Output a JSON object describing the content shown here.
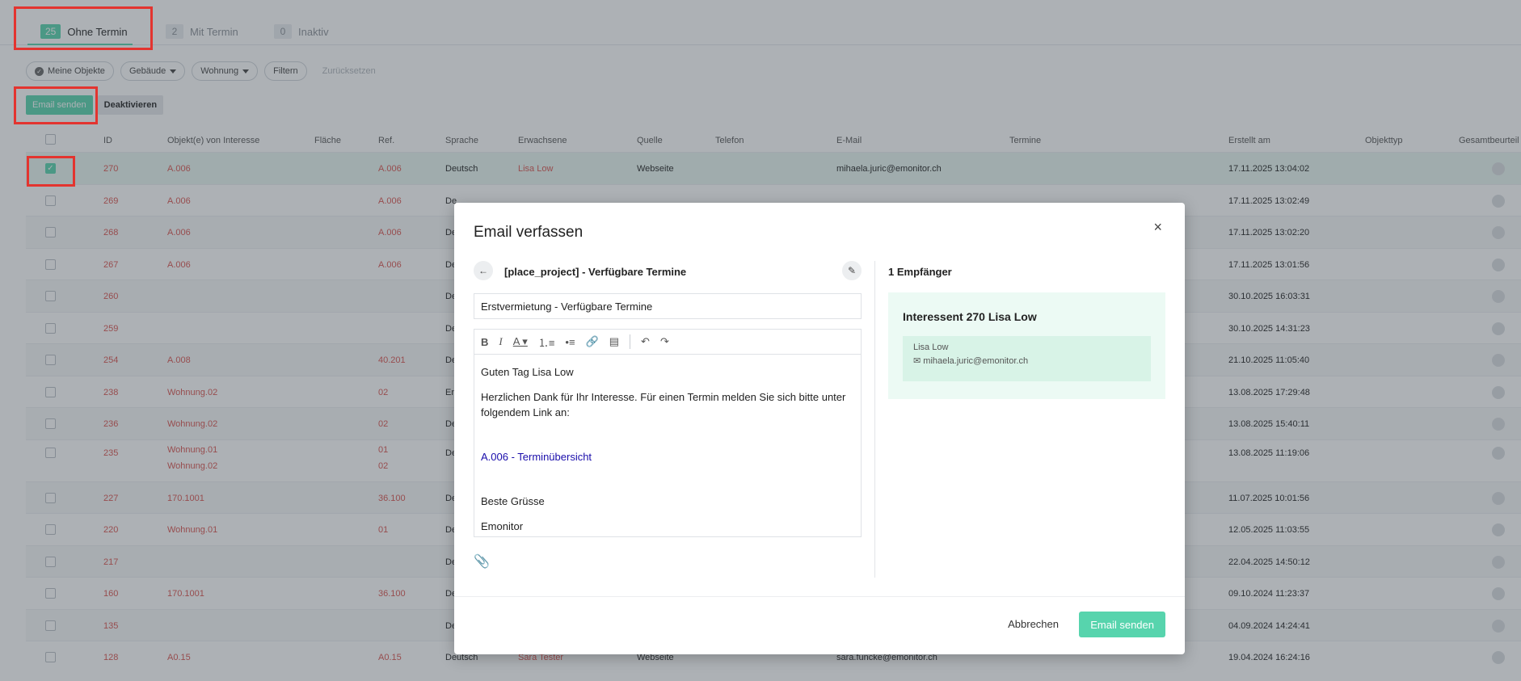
{
  "tabs": [
    {
      "count": "25",
      "label": "Ohne Termin"
    },
    {
      "count": "2",
      "label": "Mit Termin"
    },
    {
      "count": "0",
      "label": "Inaktiv"
    }
  ],
  "filters": {
    "meine_objekte": "Meine Objekte",
    "gebaeude": "Gebäude",
    "wohnung": "Wohnung",
    "filtern": "Filtern",
    "zuruecksetzen": "Zurücksetzen"
  },
  "actions": {
    "email_senden": "Email senden",
    "deaktivieren": "Deaktivieren"
  },
  "table": {
    "headers": [
      "ID",
      "Objekt(e) von Interesse",
      "Fläche",
      "Ref.",
      "Sprache",
      "Erwachsene",
      "Quelle",
      "Telefon",
      "E-Mail",
      "Termine",
      "Erstellt am",
      "Objekttyp",
      "Gesamtbeurteil"
    ],
    "rows": [
      {
        "id": "270",
        "obj": "A.006",
        "obj2": "",
        "ref": "A.006",
        "ref2": "",
        "sprache": "Deutsch",
        "erw": "Lisa Low",
        "quelle": "Webseite",
        "email": "mihaela.juric@emonitor.ch",
        "erstellt": "17.11.2025 13:04:02"
      },
      {
        "id": "269",
        "obj": "A.006",
        "obj2": "",
        "ref": "A.006",
        "ref2": "",
        "sprache": "De",
        "erw": "",
        "quelle": "",
        "email": "",
        "erstellt": "17.11.2025 13:02:49"
      },
      {
        "id": "268",
        "obj": "A.006",
        "obj2": "",
        "ref": "A.006",
        "ref2": "",
        "sprache": "De",
        "erw": "",
        "quelle": "",
        "email": "",
        "erstellt": "17.11.2025 13:02:20"
      },
      {
        "id": "267",
        "obj": "A.006",
        "obj2": "",
        "ref": "A.006",
        "ref2": "",
        "sprache": "De",
        "erw": "",
        "quelle": "",
        "email": "",
        "erstellt": "17.11.2025 13:01:56"
      },
      {
        "id": "260",
        "obj": "",
        "obj2": "",
        "ref": "",
        "ref2": "",
        "sprache": "De",
        "erw": "",
        "quelle": "",
        "email": "",
        "erstellt": "30.10.2025 16:03:31"
      },
      {
        "id": "259",
        "obj": "",
        "obj2": "",
        "ref": "",
        "ref2": "",
        "sprache": "De",
        "erw": "",
        "quelle": "",
        "email": "",
        "erstellt": "30.10.2025 14:31:23"
      },
      {
        "id": "254",
        "obj": "A.008",
        "obj2": "",
        "ref": "40.201",
        "ref2": "",
        "sprache": "De",
        "erw": "",
        "quelle": "",
        "email": "",
        "erstellt": "21.10.2025 11:05:40"
      },
      {
        "id": "238",
        "obj": "Wohnung.02",
        "obj2": "",
        "ref": "02",
        "ref2": "",
        "sprache": "En",
        "erw": "",
        "quelle": "",
        "email": "",
        "erstellt": "13.08.2025 17:29:48"
      },
      {
        "id": "236",
        "obj": "Wohnung.02",
        "obj2": "",
        "ref": "02",
        "ref2": "",
        "sprache": "De",
        "erw": "",
        "quelle": "",
        "email": "",
        "erstellt": "13.08.2025 15:40:11"
      },
      {
        "id": "235",
        "obj": "Wohnung.01",
        "obj2": "Wohnung.02",
        "ref": "01",
        "ref2": "02",
        "sprache": "De",
        "erw": "",
        "quelle": "",
        "email": "",
        "erstellt": "13.08.2025 11:19:06"
      },
      {
        "id": "227",
        "obj": "170.1001",
        "obj2": "",
        "ref": "36.100",
        "ref2": "",
        "sprache": "De",
        "erw": "",
        "quelle": "",
        "email": "",
        "erstellt": "11.07.2025 10:01:56"
      },
      {
        "id": "220",
        "obj": "Wohnung.01",
        "obj2": "",
        "ref": "01",
        "ref2": "",
        "sprache": "De",
        "erw": "",
        "quelle": "",
        "email": "",
        "erstellt": "12.05.2025 11:03:55"
      },
      {
        "id": "217",
        "obj": "",
        "obj2": "",
        "ref": "",
        "ref2": "",
        "sprache": "De",
        "erw": "",
        "quelle": "",
        "email": "",
        "erstellt": "22.04.2025 14:50:12"
      },
      {
        "id": "160",
        "obj": "170.1001",
        "obj2": "",
        "ref": "36.100",
        "ref2": "",
        "sprache": "De",
        "erw": "",
        "quelle": "",
        "email": "",
        "erstellt": "09.10.2024 11:23:37"
      },
      {
        "id": "135",
        "obj": "",
        "obj2": "",
        "ref": "",
        "ref2": "",
        "sprache": "De",
        "erw": "",
        "quelle": "",
        "email": "",
        "erstellt": "04.09.2024 14:24:41"
      },
      {
        "id": "128",
        "obj": "A0.15",
        "obj2": "",
        "ref": "A0.15",
        "ref2": "",
        "sprache": "Deutsch",
        "erw": "Sara Tester",
        "quelle": "Webseite",
        "email": "sara.funcke@emonitor.ch",
        "erstellt": "19.04.2024 16:24:16"
      }
    ]
  },
  "modal": {
    "title": "Email verfassen",
    "close": "×",
    "template_name": "[place_project] - Verfügbare Termine",
    "subject": "Erstvermietung - Verfügbare Termine",
    "body": {
      "greeting": "Guten Tag Lisa Low",
      "paragraph": "Herzlichen Dank für Ihr Interesse. Für einen Termin melden Sie sich bitte unter folgendem Link an:",
      "link": "A.006 - Terminübersicht",
      "closing": "Beste Grüsse",
      "signature": "Emonitor"
    },
    "recipients": {
      "title": "1 Empfänger",
      "card_title": "Interessent 270 Lisa Low",
      "name": "Lisa Low",
      "email": "mihaela.juric@emonitor.ch"
    },
    "cancel": "Abbrechen",
    "send": "Email senden"
  },
  "colors": {
    "accent": "#57d4ad",
    "highlight": "#e3342f",
    "link_red": "#d9534f"
  }
}
